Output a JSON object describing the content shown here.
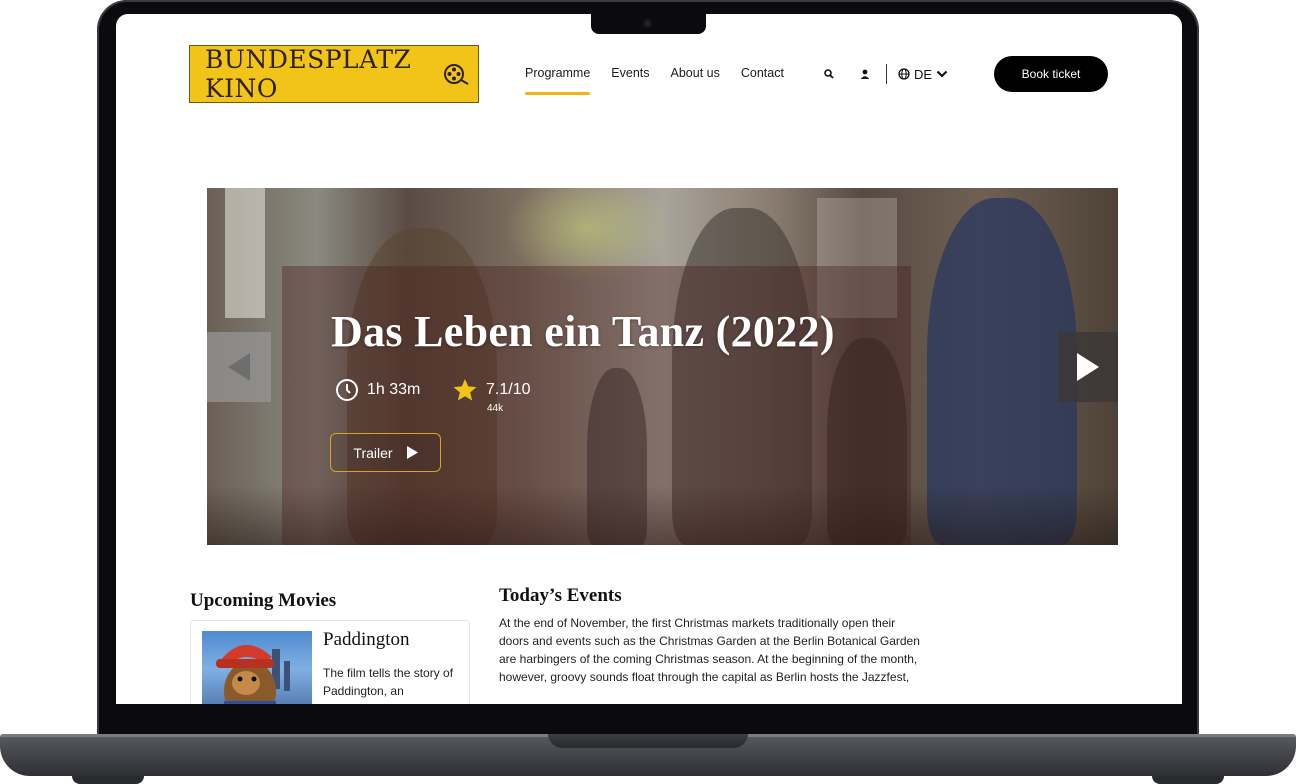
{
  "brand": {
    "logo_text": "BUNDESPLATZ KINO",
    "accent": "#f2c318"
  },
  "nav": {
    "items": [
      {
        "label": "Programme",
        "active": true
      },
      {
        "label": "Events",
        "active": false
      },
      {
        "label": "About us",
        "active": false
      },
      {
        "label": "Contact",
        "active": false
      }
    ]
  },
  "utility": {
    "search_icon": "search-icon",
    "account_icon": "user-icon",
    "language": "DE"
  },
  "cta": {
    "book_label": "Book ticket"
  },
  "hero": {
    "title": "Das Leben ein Tanz (2022)",
    "runtime": "1h 33m",
    "rating": "7.1/10",
    "votes": "44k",
    "trailer_label": "Trailer"
  },
  "upcoming": {
    "heading": "Upcoming Movies",
    "movies": [
      {
        "title": "Paddington",
        "description": "The film tells the story of Paddington, an"
      }
    ]
  },
  "events": {
    "heading": "Today’s Events",
    "text": "At the end of November, the first Christmas markets traditionally open their doors and events such as the Christmas Garden at the Berlin Botanical Garden are harbingers of the coming Christmas season. At the beginning of the month, however, groovy sounds float through the capital as Berlin hosts the Jazzfest,"
  }
}
